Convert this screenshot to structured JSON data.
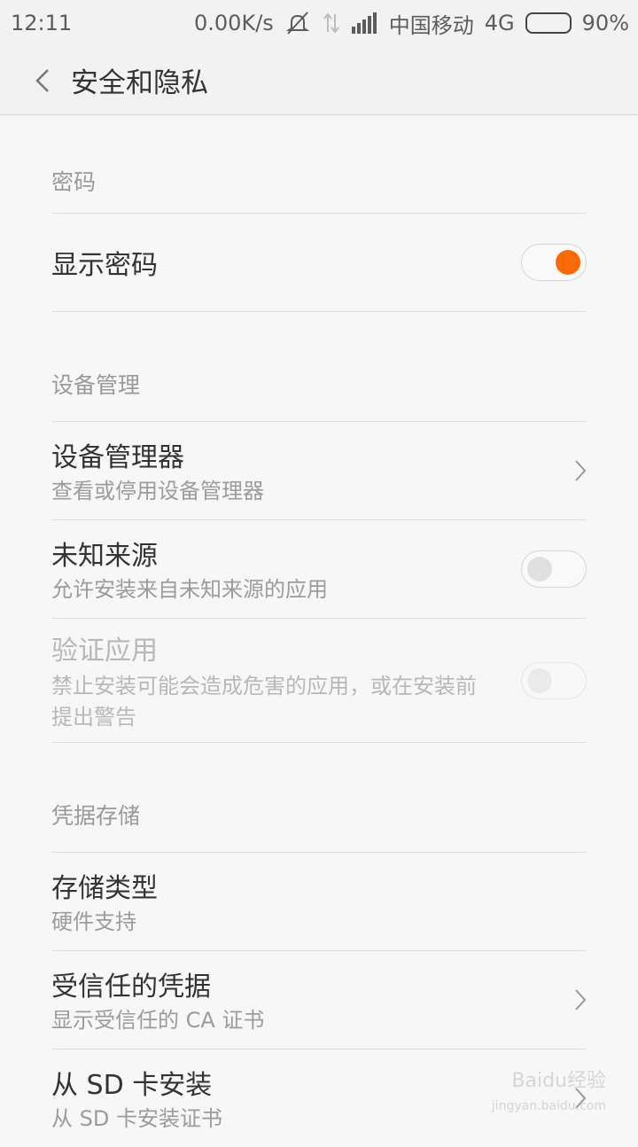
{
  "status_bar": {
    "time": "12:11",
    "speed": "0.00K/s",
    "carrier": "中国移动",
    "network": "4G",
    "battery": "90%",
    "battery_level": 0.9,
    "icons": [
      "mute-icon",
      "data-arrows-icon",
      "signal-icon",
      "battery-icon"
    ]
  },
  "header": {
    "back_icon": "back-chevron-icon",
    "title": "安全和隐私"
  },
  "sections": {
    "password": {
      "label": "密码",
      "show_password": {
        "title": "显示密码",
        "toggle": "on"
      }
    },
    "device_admin": {
      "label": "设备管理",
      "device_manager": {
        "title": "设备管理器",
        "subtitle": "查看或停用设备管理器"
      },
      "unknown_sources": {
        "title": "未知来源",
        "subtitle": "允许安装来自未知来源的应用",
        "toggle": "off"
      },
      "verify_apps": {
        "title": "验证应用",
        "subtitle": "禁止安装可能会造成危害的应用，或在安装前提出警告",
        "toggle": "off",
        "disabled": true
      }
    },
    "credential_storage": {
      "label": "凭据存储",
      "storage_type": {
        "title": "存储类型",
        "subtitle": "硬件支持"
      },
      "trusted_credentials": {
        "title": "受信任的凭据",
        "subtitle": "显示受信任的 CA 证书"
      },
      "install_from_sd": {
        "title": "从 SD 卡安装",
        "subtitle": "从 SD 卡安装证书"
      }
    }
  },
  "watermark": {
    "text": "Baidu经验",
    "sub": "jingyan.baidu.com"
  },
  "colors": {
    "accent": "#ff6a00",
    "battery": "#39d223"
  }
}
